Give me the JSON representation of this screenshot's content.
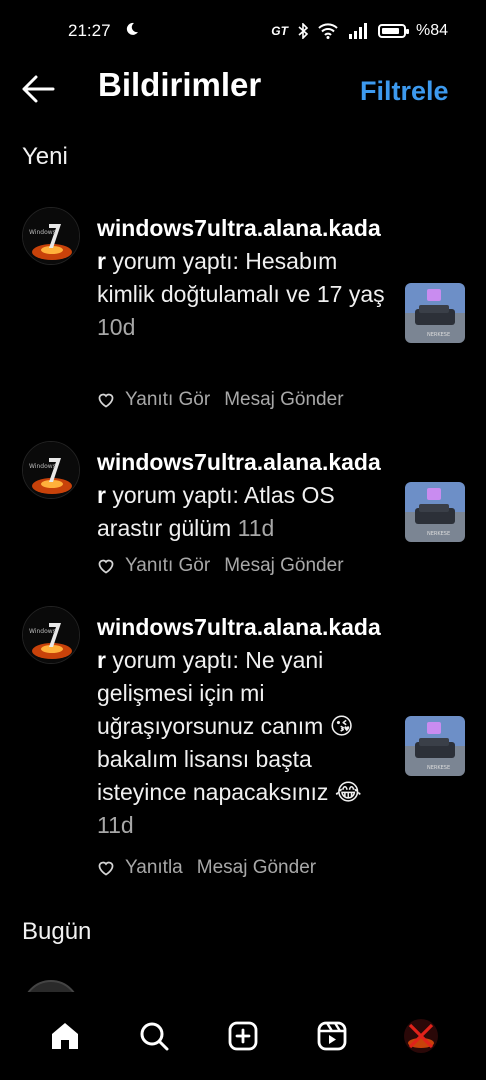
{
  "status_bar": {
    "time": "21:27",
    "battery": "%84",
    "battery_level": 0.84
  },
  "header": {
    "title": "Bildirimler",
    "filter_label": "Filtrele"
  },
  "sections": {
    "new": "Yeni",
    "today": "Bugün"
  },
  "notifications": [
    {
      "username": "windows7ultra.alana.kadar",
      "message": " yorum yaptı: Hesabım kimlik doğtulamalı ve 17 yaş ",
      "time": "10d",
      "actions": [
        "Yanıtı Gör",
        "Mesaj Gönder"
      ]
    },
    {
      "username": "windows7ultra.alana.kadar",
      "message": " yorum yaptı: Atlas OS arastır gülüm ",
      "time": "11d",
      "actions": [
        "Yanıtı Gör",
        "Mesaj Gönder"
      ]
    },
    {
      "username": "windows7ultra.alana.kadar",
      "message": " yorum yaptı: Ne yani gelişmesi için mi uğraşıyorsunuz canım 😘 bakalım lisansı başta isteyince napacaksınız 😂 ",
      "time": "11d",
      "actions": [
        "Yanıtla",
        "Mesaj Gönder"
      ]
    }
  ],
  "colors": {
    "accent": "#3d9aef",
    "muted": "#a8a8a8",
    "background": "#000000"
  },
  "bottom_nav": [
    "home-icon",
    "search-icon",
    "create-icon",
    "reels-icon",
    "profile-avatar"
  ]
}
